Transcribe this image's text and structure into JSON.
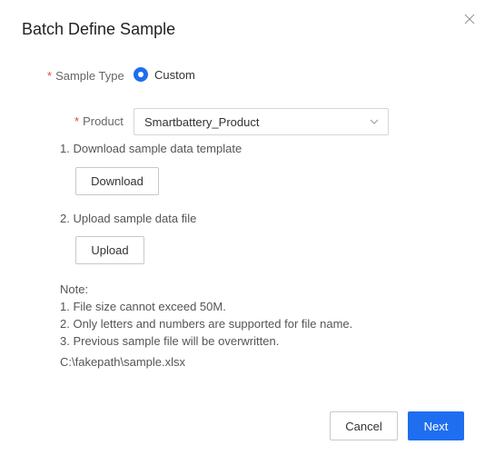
{
  "dialog": {
    "title": "Batch Define Sample",
    "close_icon": "close-icon"
  },
  "form": {
    "sample_type": {
      "required_mark": "*",
      "label": "Sample Type",
      "selected_option": "Custom"
    },
    "product": {
      "required_mark": "*",
      "label": "Product",
      "value": "Smartbattery_Product",
      "icon": "chevron-down-icon"
    }
  },
  "steps": {
    "download": {
      "label": "1. Download sample data template",
      "button": "Download"
    },
    "upload": {
      "label": "2. Upload sample data file",
      "button": "Upload"
    }
  },
  "notes": {
    "heading": "Note:",
    "items": [
      "1. File size cannot exceed 50M.",
      "2. Only letters and numbers are supported for file name.",
      "3. Previous sample file will be overwritten."
    ]
  },
  "uploaded_file": "C:\\fakepath\\sample.xlsx",
  "footer": {
    "cancel": "Cancel",
    "next": "Next"
  },
  "colors": {
    "primary": "#1f6ef0",
    "required": "#e0483a"
  }
}
